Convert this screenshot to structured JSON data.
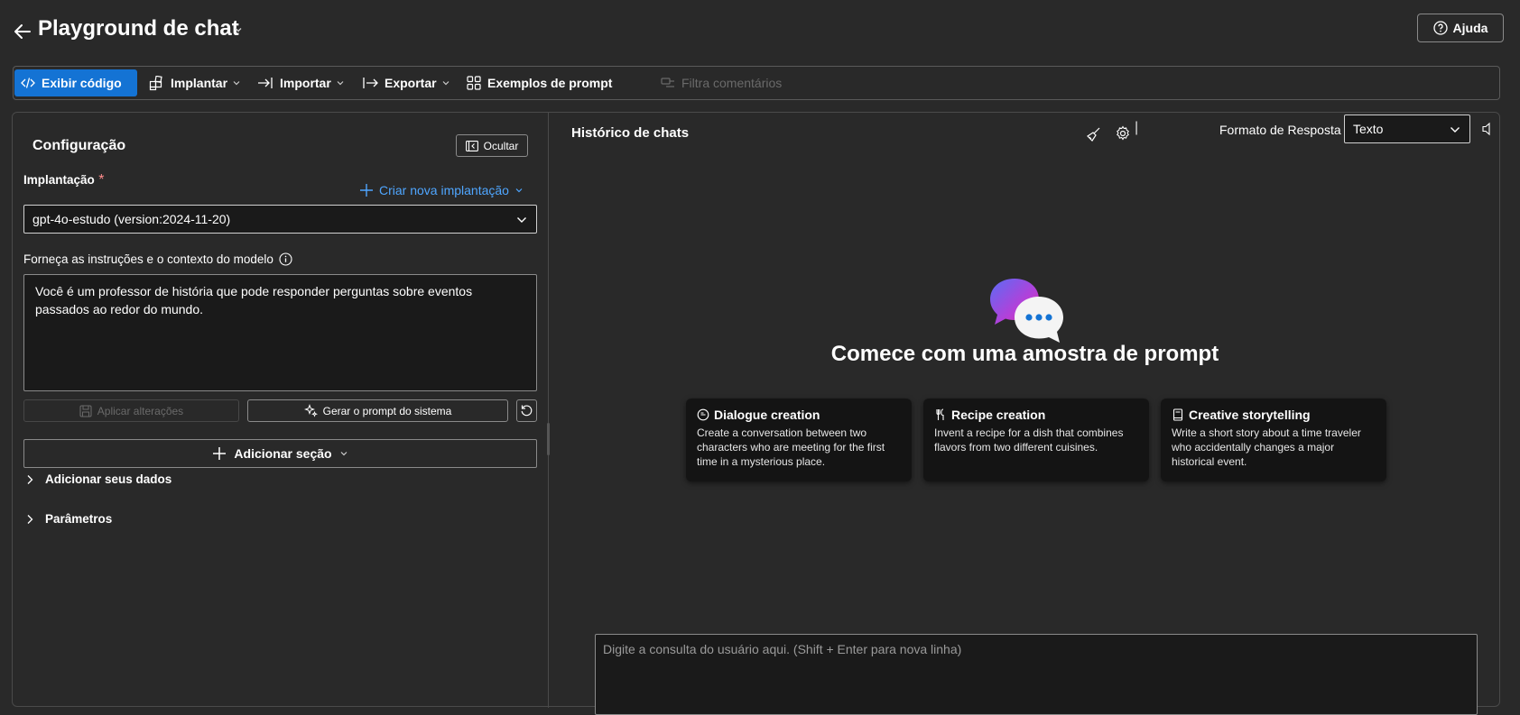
{
  "header": {
    "title": "Playground de chat",
    "help_label": "Ajuda"
  },
  "toolbar": {
    "show_code": "Exibir código",
    "deploy": "Implantar",
    "import": "Importar",
    "export": "Exportar",
    "prompt_examples": "Exemplos de prompt",
    "filter_comments": "Filtra comentários"
  },
  "config": {
    "title": "Configuração",
    "hide_label": "Ocultar",
    "deployment_label": "Implantação",
    "required_mark": "*",
    "create_deployment": "Criar nova implantação",
    "deployment_value": "gpt-4o-estudo (version:2024-11-20)",
    "instructions_label": "Forneça as instruções e o contexto do modelo",
    "instructions_value": "Você é um professor de história que pode responder perguntas sobre eventos passados ao redor do mundo.",
    "apply_changes": "Aplicar alterações",
    "generate_prompt": "Gerar o prompt do sistema",
    "add_section": "Adicionar seção",
    "add_data": "Adicionar seus dados",
    "parameters": "Parâmetros"
  },
  "chat": {
    "history_title": "Histórico de chats",
    "divider": "|",
    "response_format_label": "Formato de Resposta",
    "response_format_value": "Texto",
    "start_title": "Comece com uma amostra de prompt",
    "query_placeholder": "Digite a consulta do usuário aqui. (Shift + Enter para nova linha)",
    "cards": [
      {
        "title": "Dialogue creation",
        "description": "Create a conversation between two characters who are meeting for the first time in a mysterious place."
      },
      {
        "title": "Recipe creation",
        "description": "Invent a recipe for a dish that combines flavors from two different cuisines."
      },
      {
        "title": "Creative storytelling",
        "description": "Write a short story about a time traveler who accidentally changes a major historical event."
      }
    ]
  },
  "colors": {
    "background": "#292929",
    "accent": "#1473d4",
    "link": "#4fa6ff",
    "input_bg": "#1a1a1a"
  },
  "icons": [
    "back-arrow-icon",
    "chevron-down-icon",
    "help-icon",
    "code-icon",
    "grid-icon",
    "import-icon",
    "export-icon",
    "examples-icon",
    "filter-icon",
    "hide-panel-icon",
    "plus-icon",
    "info-icon",
    "save-icon",
    "sparkle-icon",
    "reset-icon",
    "chevron-right-icon",
    "broom-icon",
    "gear-icon",
    "speaker-icon",
    "chat-bubbles-icon",
    "chat-bubble-icon",
    "utensils-icon",
    "book-icon"
  ]
}
